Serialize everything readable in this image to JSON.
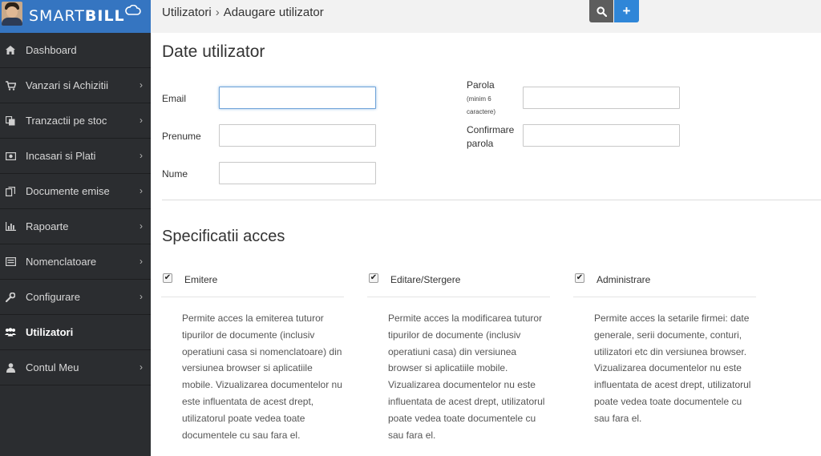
{
  "brand": {
    "logo_text_smart": "SMART",
    "logo_text_bill": "BILL"
  },
  "sidebar": {
    "items": [
      {
        "label": "Dashboard",
        "icon": "home-icon",
        "chevron": false,
        "active": false
      },
      {
        "label": "Vanzari si Achizitii",
        "icon": "cart-icon",
        "chevron": true,
        "active": false
      },
      {
        "label": "Tranzactii pe stoc",
        "icon": "copy-icon",
        "chevron": true,
        "active": false
      },
      {
        "label": "Incasari si Plati",
        "icon": "money-icon",
        "chevron": true,
        "active": false
      },
      {
        "label": "Documente emise",
        "icon": "documents-icon",
        "chevron": true,
        "active": false
      },
      {
        "label": "Rapoarte",
        "icon": "bar-chart-icon",
        "chevron": true,
        "active": false
      },
      {
        "label": "Nomenclatoare",
        "icon": "list-icon",
        "chevron": true,
        "active": false
      },
      {
        "label": "Configurare",
        "icon": "wrench-icon",
        "chevron": true,
        "active": false
      },
      {
        "label": "Utilizatori",
        "icon": "users-icon",
        "chevron": false,
        "active": true
      },
      {
        "label": "Contul Meu",
        "icon": "user-icon",
        "chevron": true,
        "active": false
      }
    ]
  },
  "header": {
    "breadcrumb_parent": "Utilizatori",
    "breadcrumb_separator": "›",
    "breadcrumb_current": "Adaugare utilizator",
    "search_icon": "search-icon",
    "add_label": "+"
  },
  "form": {
    "title": "Date utilizator",
    "email_label": "Email",
    "email_value": "",
    "prenume_label": "Prenume",
    "prenume_value": "",
    "nume_label": "Nume",
    "nume_value": "",
    "parola_label": "Parola",
    "parola_hint_1": "(minim 6",
    "parola_hint_2": "caractere)",
    "parola_value": "",
    "confirm_label_1": "Confirmare",
    "confirm_label_2": "parola",
    "confirm_value": ""
  },
  "access": {
    "title": "Specificatii acces",
    "columns": [
      {
        "label": "Emitere",
        "checked": true,
        "description": "Permite acces la emiterea tuturor tipurilor de documente (inclusiv operatiuni casa si nomenclatoare) din versiunea browser si aplicatiile mobile. Vizualizarea documentelor nu este influentata de acest drept, utilizatorul poate vedea toate documentele cu sau fara el."
      },
      {
        "label": "Editare/Stergere",
        "checked": true,
        "description": "Permite acces la modificarea tuturor tipurilor de documente (inclusiv operatiuni casa) din versiunea browser si aplicatiile mobile. Vizualizarea documentelor nu este influentata de acest drept, utilizatorul poate vedea toate documentele cu sau fara el."
      },
      {
        "label": "Administrare",
        "checked": true,
        "description": "Permite acces la setarile firmei: date generale, serii documente, conturi, utilizatori etc din versiunea browser. Vizualizarea documentelor nu este influentata de acest drept, utilizatorul poate vedea toate documentele cu sau fara el."
      }
    ]
  },
  "colors": {
    "sidebar_bg": "#2b2d30",
    "brand_bg": "#3575c1",
    "topbar_bg": "#f2f2f2",
    "search_button": "#5d5d5d",
    "add_button": "#2f86d8",
    "input_focus": "#6ea2d8"
  }
}
